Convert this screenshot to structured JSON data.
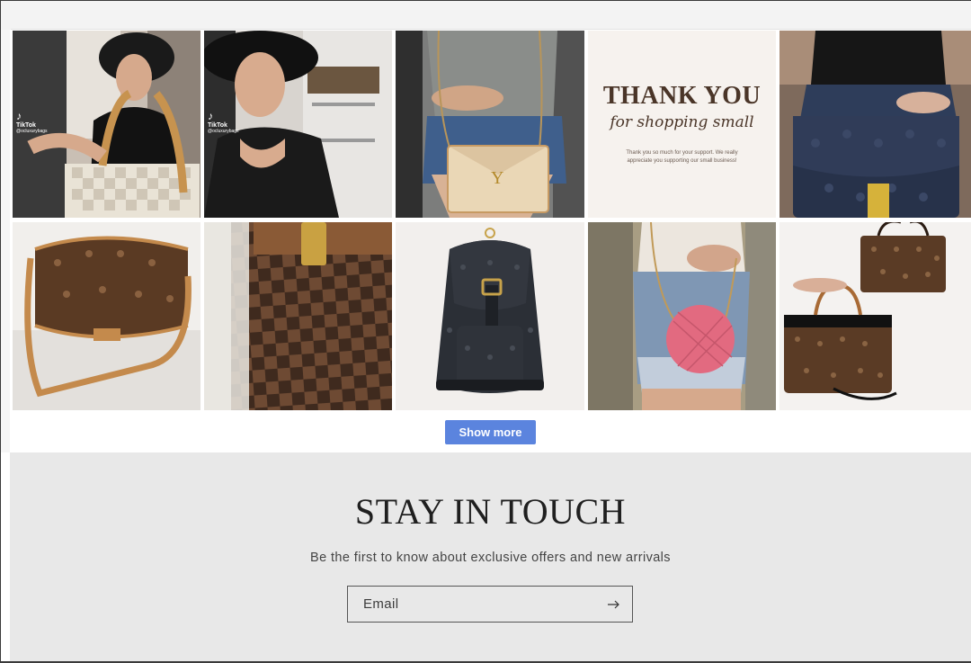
{
  "gallery": {
    "tiles": [
      {
        "name": "tiktok-video-tote",
        "alt": "Woman holding damier azur tote",
        "overlay": "TikTok",
        "handle": "@ocluxurybags"
      },
      {
        "name": "tiktok-video-talking",
        "alt": "Woman talking in closet",
        "overlay": "TikTok",
        "handle": "@ocluxurybags"
      },
      {
        "name": "ysl-raffia-bag",
        "alt": "YSL raffia crossbody bag"
      },
      {
        "name": "thank-you-card",
        "alt": "Thank you for shopping small card",
        "title": "THANK YOU",
        "script": "for shopping small",
        "note_1": "Thank you so much for your support. We really",
        "note_2": "appreciate you supporting our small business!"
      },
      {
        "name": "lv-empreinte-bag",
        "alt": "Navy monogram empreinte bag"
      },
      {
        "name": "lv-menilmontant-bag",
        "alt": "Monogram saddle crossbody"
      },
      {
        "name": "damier-closeup",
        "alt": "Damier ebene canvas close-up"
      },
      {
        "name": "lv-denim-backpack",
        "alt": "Monogram denim backpack"
      },
      {
        "name": "pink-round-bag",
        "alt": "Pink quilted round bag"
      },
      {
        "name": "lv-pallas-bags",
        "alt": "Two monogram handbags"
      }
    ]
  },
  "show_more": {
    "label": "Show more"
  },
  "newsletter": {
    "title": "STAY IN TOUCH",
    "subtitle": "Be the first to know about exclusive offers and new arrivals",
    "email_placeholder": "Email"
  },
  "colors": {
    "button": "#5b84de",
    "footer_bg": "#e8e8e8"
  }
}
